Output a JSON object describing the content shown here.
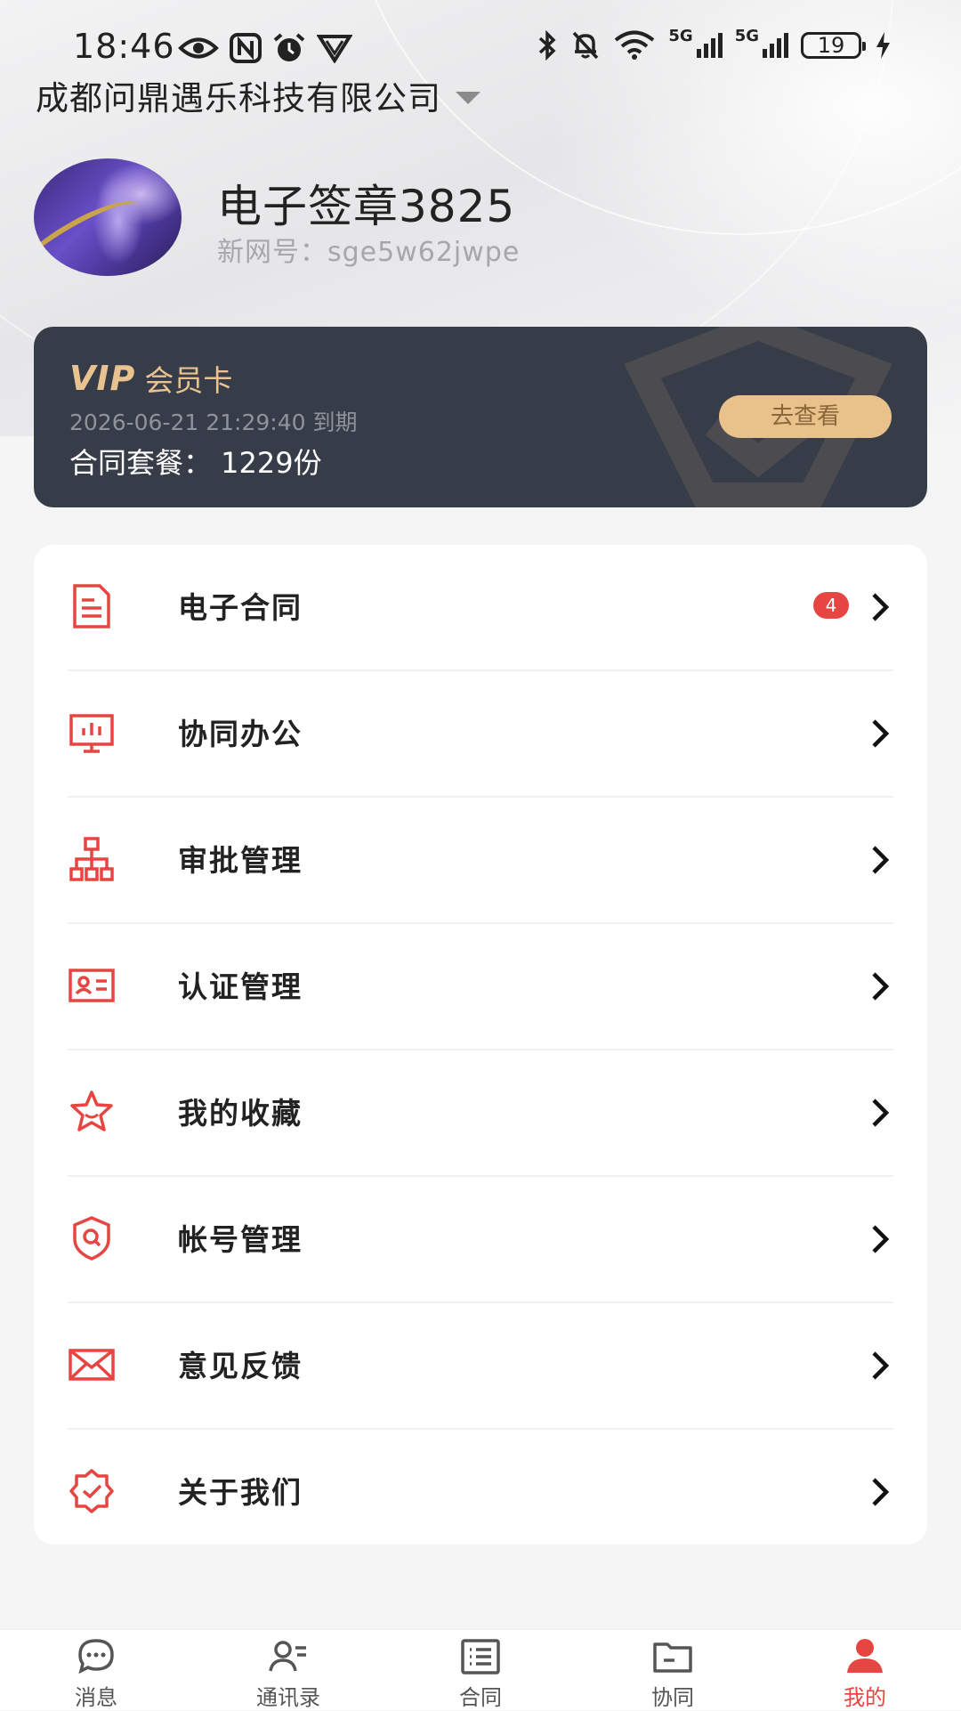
{
  "status_bar": {
    "time": "18:46",
    "battery_level": "19",
    "network_labels": [
      "5G",
      "5G"
    ],
    "left_icons": [
      "eye-icon",
      "nfc-icon",
      "alarm-icon",
      "vpn-shield-icon"
    ],
    "right_icons": [
      "bluetooth-icon",
      "mute-bell-icon",
      "wifi-icon",
      "signal-5g-icon",
      "signal-5g-icon",
      "battery-icon",
      "charging-icon"
    ]
  },
  "header": {
    "company_name": "成都问鼎遇乐科技有限公司",
    "user_name": "电子签章3825",
    "user_id_label": "新网号：",
    "user_id": "sge5w62jwpe"
  },
  "vip_card": {
    "logo_text": "VIP",
    "title": "会员卡",
    "expire_text": "2026-06-21 21:29:40 到期",
    "plan_text": "合同套餐：  1229份",
    "button_label": "去查看",
    "accent_color": "#e8c28f"
  },
  "menu": {
    "items": [
      {
        "label": "电子合同",
        "icon": "document-icon",
        "badge": "4"
      },
      {
        "label": "协同办公",
        "icon": "monitor-icon"
      },
      {
        "label": "审批管理",
        "icon": "org-chart-icon"
      },
      {
        "label": "认证管理",
        "icon": "id-card-icon"
      },
      {
        "label": "我的收藏",
        "icon": "star-icon"
      },
      {
        "label": "帐号管理",
        "icon": "shield-search-icon"
      },
      {
        "label": "意见反馈",
        "icon": "mail-icon"
      },
      {
        "label": "关于我们",
        "icon": "badge-check-icon"
      }
    ],
    "icon_color": "#e64541"
  },
  "bottom_nav": {
    "items": [
      {
        "label": "消息",
        "icon": "chat-icon"
      },
      {
        "label": "通讯录",
        "icon": "contacts-icon"
      },
      {
        "label": "合同",
        "icon": "list-icon"
      },
      {
        "label": "协同",
        "icon": "folder-icon"
      },
      {
        "label": "我的",
        "icon": "person-icon",
        "active": true
      }
    ],
    "active_color": "#e64541"
  }
}
